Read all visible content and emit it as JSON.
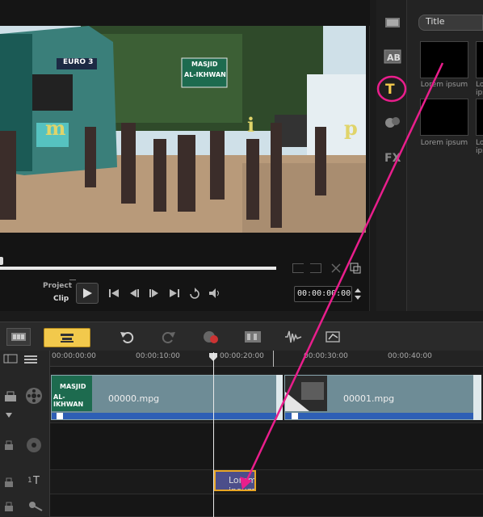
{
  "video": {
    "bus_sign": "EURO 3",
    "mosque_sign_line1": "MASJID",
    "mosque_sign_line2": "AL-IKHWAN",
    "overlay_letters": [
      "m",
      "i",
      "p"
    ]
  },
  "player": {
    "mode_project": "Project",
    "mode_clip": "Clip",
    "timecode": "00:00:00:00",
    "progress": 0.0
  },
  "library": {
    "tab_title": "Title",
    "thumbs": [
      {
        "label": "Lorem ipsum"
      },
      {
        "label": "Lorem ipsum"
      },
      {
        "label": "Lorem ipsum"
      },
      {
        "label": "Lorem ipsum"
      }
    ]
  },
  "timeline": {
    "ruler_ticks": [
      "00:00:00:00",
      "00:00:10:00",
      "00:00:20:00",
      "00:00:30:00",
      "00:00:40:00"
    ],
    "clips": [
      {
        "name": "00000.mpg",
        "thumb_line1": "MASJID",
        "thumb_line2": "AL-IKHWAN"
      },
      {
        "name": "00001.mpg"
      }
    ],
    "title_clip": "Lorem ipsum",
    "track_labels": [
      "1",
      "1"
    ]
  },
  "colors": {
    "accent": "#e91e8c",
    "title_clip_border": "#e7a526",
    "audio_strip": "#2e5fb5",
    "clip_fill": "#6e8c96"
  }
}
